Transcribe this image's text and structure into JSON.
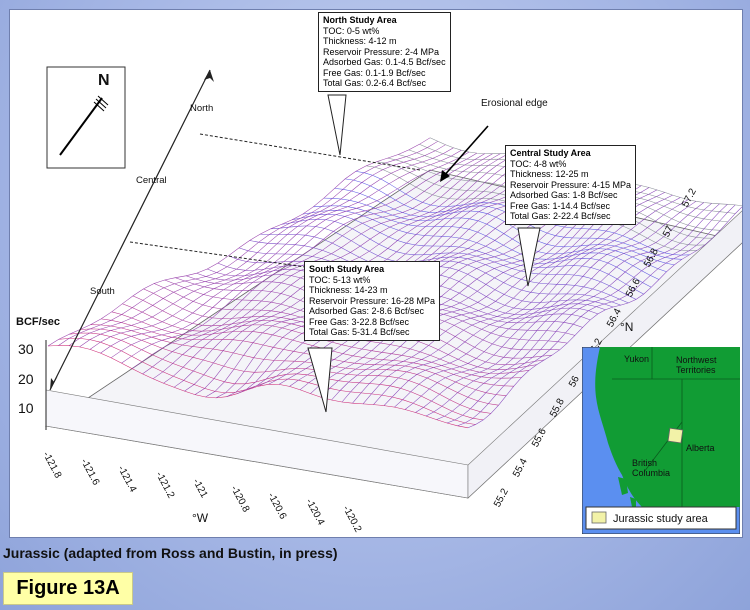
{
  "compass": {
    "label": "N"
  },
  "zones": {
    "north": "North",
    "central": "Central",
    "south": "South"
  },
  "z_axis": {
    "unit": "BCF/sec",
    "ticks": [
      "30",
      "20",
      "10"
    ]
  },
  "x_axis": {
    "unit": "°W",
    "ticks": [
      "-121.8",
      "-121.6",
      "-121.4",
      "-121.2",
      "-121",
      "-120.8",
      "-120.6",
      "-120.4",
      "-120.2"
    ]
  },
  "y_axis": {
    "unit": "°N",
    "ticks": [
      "55.2",
      "55.4",
      "55.6",
      "55.8",
      "56",
      "56.2",
      "56.4",
      "56.6",
      "56.8",
      "57",
      "57.2"
    ]
  },
  "erosional_edge": "Erosional edge",
  "areas": {
    "north": {
      "title": "North Study Area",
      "lines": [
        "TOC: 0-5 wt%",
        "Thickness: 4-12 m",
        "Reservoir Pressure: 2-4 MPa",
        "Adsorbed Gas: 0.1-4.5 Bcf/sec",
        "Free Gas: 0.1-1.9 Bcf/sec",
        "Total Gas: 0.2-6.4 Bcf/sec"
      ]
    },
    "central": {
      "title": "Central Study Area",
      "lines": [
        "TOC: 4-8 wt%",
        "Thickness: 12-25 m",
        "Reservoir Pressure: 4-15 MPa",
        "Adsorbed Gas: 1-8 Bcf/sec",
        "Free Gas: 1-14.4 Bcf/sec",
        "Total Gas: 2-22.4 Bcf/sec"
      ]
    },
    "south": {
      "title": "South Study Area",
      "lines": [
        "TOC: 5-13 wt%",
        "Thickness: 14-23 m",
        "Reservoir Pressure: 16-28 MPa",
        "Adsorbed Gas: 2-8.6 Bcf/sec",
        "Free Gas: 3-22.8 Bcf/sec",
        "Total Gas: 5-31.4 Bcf/sec"
      ]
    }
  },
  "map": {
    "labels": {
      "yukon": "Yukon",
      "nwt": "Northwest Territories",
      "alberta": "Alberta",
      "bc": "British Columbia"
    },
    "legend": "Jurassic study area",
    "colors": {
      "land": "#119c34",
      "water": "#5b8ff0",
      "study": "#f2f2a8"
    }
  },
  "caption": "Jurassic (adapted from Ross and Bustin, in press)",
  "figure_label": "Figure 13A"
}
